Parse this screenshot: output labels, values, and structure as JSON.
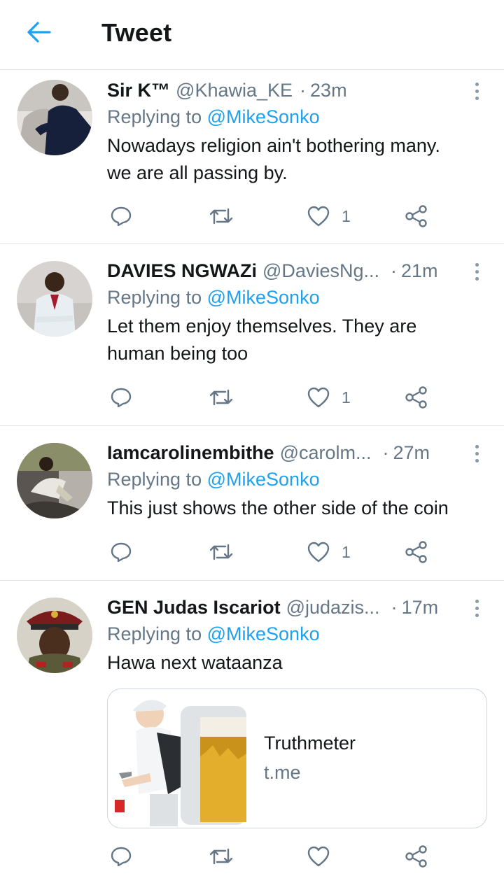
{
  "header": {
    "title": "Tweet",
    "back_icon": "arrow-left-icon",
    "accent": "#1da1f2"
  },
  "tweets": [
    {
      "name": "Sir K™",
      "handle": "@Khawia_KE",
      "separator": "·",
      "time": "23m",
      "reply_prefix": "Replying to",
      "reply_to": "@MikeSonko",
      "text_lines": [
        "Nowadays religion ain't bothering many.",
        "we are all passing by."
      ],
      "likes": "1"
    },
    {
      "name": "DAVIES NGWAZi",
      "handle": "@DaviesNg...",
      "separator": "·",
      "time": "21m",
      "reply_prefix": "Replying to",
      "reply_to": "@MikeSonko",
      "text_lines": [
        "Let them enjoy themselves. They are",
        "human being too"
      ],
      "likes": "1"
    },
    {
      "name": "Iamcarolinembithe",
      "handle": "@carolm...",
      "separator": "·",
      "time": "27m",
      "reply_prefix": "Replying to",
      "reply_to": "@MikeSonko",
      "text_lines": [
        "This just shows the other side of the coin"
      ],
      "likes": "1"
    },
    {
      "name": "GEN Judas Iscariot",
      "handle": "@judazis...",
      "separator": "·",
      "time": "17m",
      "reply_prefix": "Replying to",
      "reply_to": "@MikeSonko",
      "text_lines": [
        "Hawa next wataanza"
      ],
      "card": {
        "title": "Truthmeter",
        "domain": "t.me"
      },
      "likes": ""
    }
  ],
  "icons": [
    "reply-icon",
    "retweet-icon",
    "like-icon",
    "share-icon",
    "more-icon"
  ]
}
